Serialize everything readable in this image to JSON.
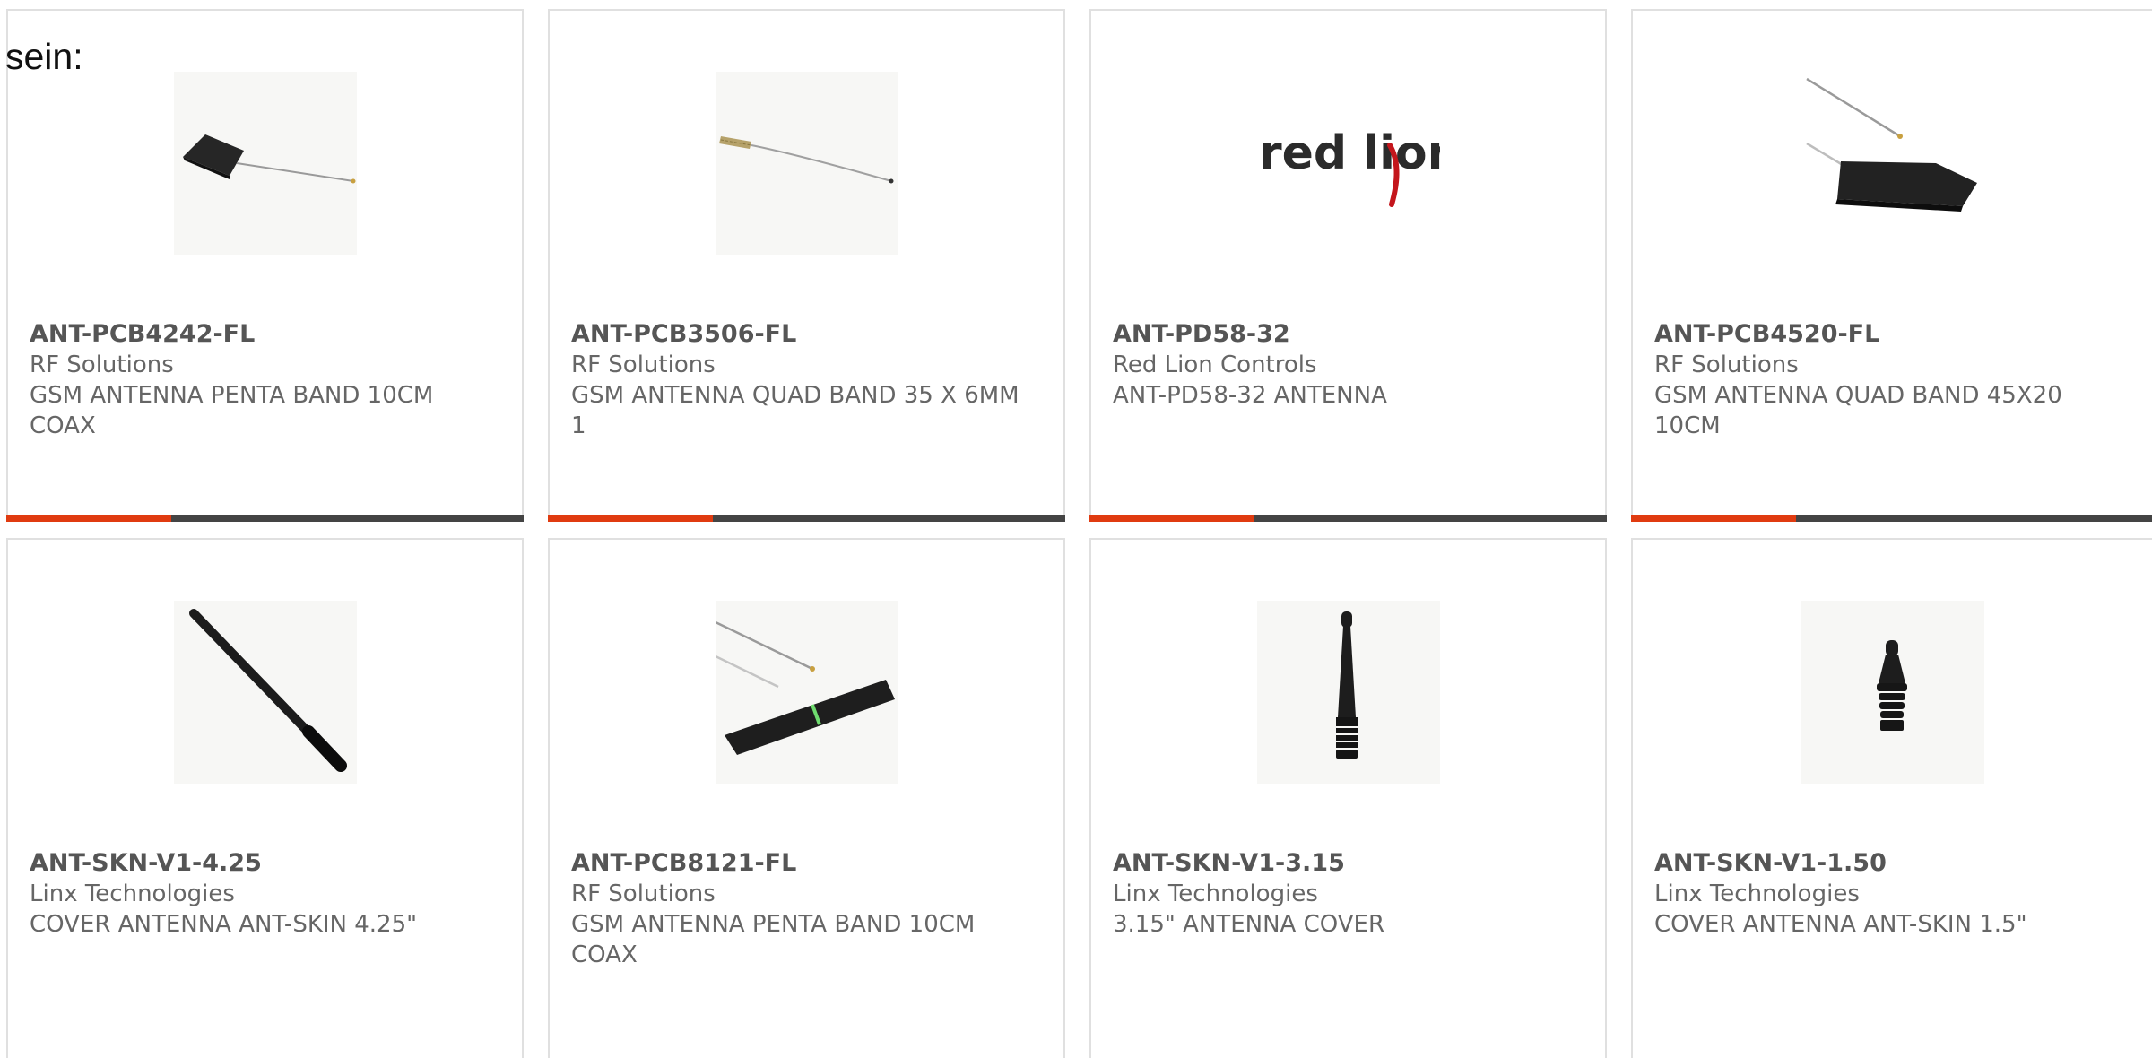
{
  "intro_text": "sein:",
  "accent_color": "#e03b10",
  "bar_color": "#444444",
  "cards": [
    {
      "part_number": "ANT-PCB4242-FL",
      "manufacturer": "RF Solutions",
      "description": "GSM ANTENNA PENTA BAND 10CM COAX",
      "image": "small-pcb-antenna-icon"
    },
    {
      "part_number": "ANT-PCB3506-FL",
      "manufacturer": "RF Solutions",
      "description": "GSM ANTENNA QUAD BAND 35 X 6MM 1",
      "image": "thin-pcb-antenna-icon"
    },
    {
      "part_number": "ANT-PD58-32",
      "manufacturer": "Red Lion Controls",
      "description": "ANT-PD58-32 ANTENNA",
      "image": "red-lion-logo",
      "logo_text": "red lion"
    },
    {
      "part_number": "ANT-PCB4520-FL",
      "manufacturer": "RF Solutions",
      "description": "GSM ANTENNA QUAD BAND 45X20 10CM",
      "image": "pcb-antenna-cable-icon"
    },
    {
      "part_number": "ANT-SKN-V1-4.25",
      "manufacturer": "Linx Technologies",
      "description": "COVER ANTENNA ANT-SKIN 4.25\"",
      "image": "whip-antenna-icon"
    },
    {
      "part_number": "ANT-PCB8121-FL",
      "manufacturer": "RF Solutions",
      "description": "GSM ANTENNA PENTA BAND 10CM COAX",
      "image": "long-pcb-antenna-icon"
    },
    {
      "part_number": "ANT-SKN-V1-3.15",
      "manufacturer": "Linx Technologies",
      "description": "3.15\" ANTENNA COVER",
      "image": "stub-antenna-icon"
    },
    {
      "part_number": "ANT-SKN-V1-1.50",
      "manufacturer": "Linx Technologies",
      "description": "COVER ANTENNA ANT-SKIN 1.5\"",
      "image": "short-stub-antenna-icon"
    }
  ]
}
